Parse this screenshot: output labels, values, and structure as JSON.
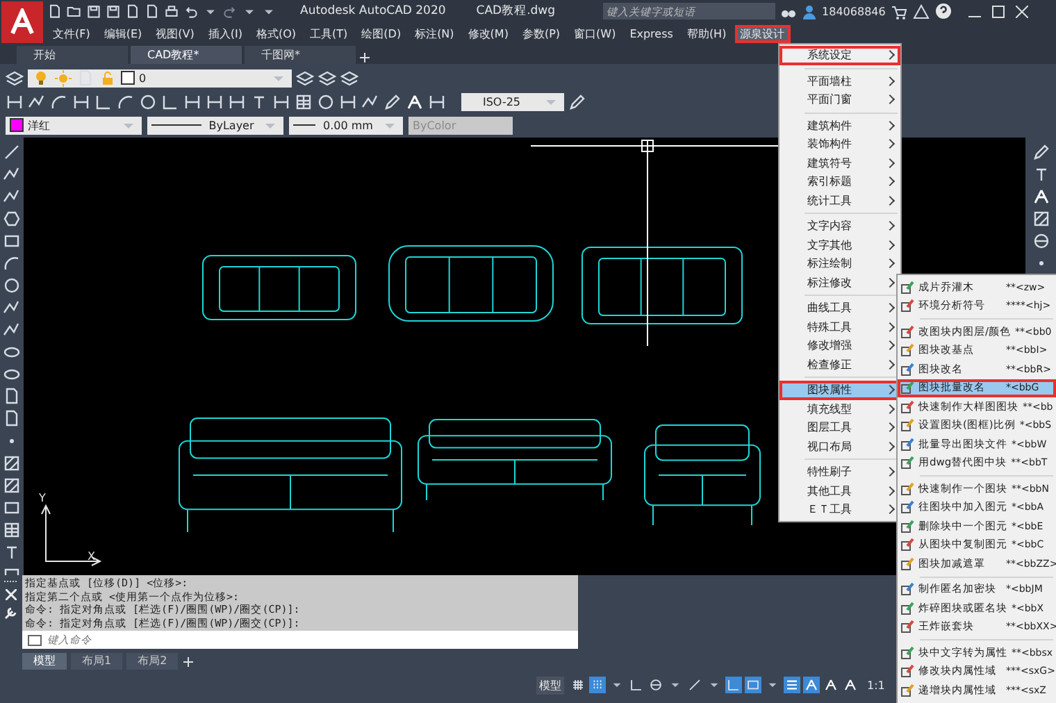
{
  "title_bar": {
    "app_title": "Autodesk AutoCAD 2020",
    "file_name": "CAD教程.dwg",
    "search": {
      "placeholder": "键入关键字或短语"
    },
    "user": "184068846"
  },
  "menu_bar": [
    {
      "label": "文件(F)",
      "selected": false,
      "highlighted": false
    },
    {
      "label": "编辑(E)",
      "selected": false,
      "highlighted": false
    },
    {
      "label": "视图(V)",
      "selected": false,
      "highlighted": false
    },
    {
      "label": "插入(I)",
      "selected": false,
      "highlighted": false
    },
    {
      "label": "格式(O)",
      "selected": false,
      "highlighted": false
    },
    {
      "label": "工具(T)",
      "selected": false,
      "highlighted": false
    },
    {
      "label": "绘图(D)",
      "selected": false,
      "highlighted": false
    },
    {
      "label": "标注(N)",
      "selected": false,
      "highlighted": false
    },
    {
      "label": "修改(M)",
      "selected": false,
      "highlighted": false
    },
    {
      "label": "参数(P)",
      "selected": false,
      "highlighted": false
    },
    {
      "label": "窗口(W)",
      "selected": false,
      "highlighted": false
    },
    {
      "label": "Express",
      "selected": false,
      "highlighted": false
    },
    {
      "label": "帮助(H)",
      "selected": false,
      "highlighted": false
    },
    {
      "label": "源泉设计",
      "selected": true,
      "highlighted": true
    }
  ],
  "doc_tabs": [
    {
      "label": "开始",
      "selected": false
    },
    {
      "label": "CAD教程*",
      "selected": true
    },
    {
      "label": "千图网*",
      "selected": false
    }
  ],
  "layer_toolbar": {
    "layer": "0"
  },
  "dim_style": "ISO-25",
  "properties": {
    "color_name": "洋红",
    "color": "#ff00ff",
    "linetype": "ByLayer",
    "lineweight": "0.00 mm",
    "plot_style": "ByColor",
    "plot_style_disabled": true
  },
  "ucs": {
    "x": "X",
    "y": "Y"
  },
  "menu": {
    "groups": [
      [
        {
          "label": "系统设定",
          "selected": false,
          "highlighted": true
        }
      ],
      [
        {
          "label": "平面墙柱",
          "selected": false,
          "highlighted": false
        },
        {
          "label": "平面门窗",
          "selected": false,
          "highlighted": false
        }
      ],
      [
        {
          "label": "建筑构件",
          "selected": false,
          "highlighted": false
        },
        {
          "label": "装饰构件",
          "selected": false,
          "highlighted": false
        },
        {
          "label": "建筑符号",
          "selected": false,
          "highlighted": false
        },
        {
          "label": "索引标题",
          "selected": false,
          "highlighted": false
        },
        {
          "label": "统计工具",
          "selected": false,
          "highlighted": false
        }
      ],
      [
        {
          "label": "文字内容",
          "selected": false,
          "highlighted": false
        },
        {
          "label": "文字其他",
          "selected": false,
          "highlighted": false
        },
        {
          "label": "标注绘制",
          "selected": false,
          "highlighted": false
        },
        {
          "label": "标注修改",
          "selected": false,
          "highlighted": false
        }
      ],
      [
        {
          "label": "曲线工具",
          "selected": false,
          "highlighted": false
        },
        {
          "label": "特殊工具",
          "selected": false,
          "highlighted": false
        },
        {
          "label": "修改增强",
          "selected": false,
          "highlighted": false
        },
        {
          "label": "检查修正",
          "selected": false,
          "highlighted": false
        }
      ],
      [
        {
          "label": "图块属性",
          "selected": true,
          "highlighted": true
        },
        {
          "label": "填充线型",
          "selected": false,
          "highlighted": false
        },
        {
          "label": "图层工具",
          "selected": false,
          "highlighted": false
        },
        {
          "label": "视口布局",
          "selected": false,
          "highlighted": false
        }
      ],
      [
        {
          "label": "特性刷子",
          "selected": false,
          "highlighted": false
        },
        {
          "label": "其他工具",
          "selected": false,
          "highlighted": false
        },
        {
          "label": "ＥＴ工具",
          "selected": false,
          "highlighted": false
        }
      ]
    ]
  },
  "submenu": {
    "groups": [
      [
        {
          "label": "成片乔灌木",
          "shortcut": "**<zw>",
          "selected": false,
          "highlighted": false
        },
        {
          "label": "环境分析符号",
          "shortcut": "****<hj>",
          "selected": false,
          "highlighted": false
        }
      ],
      [
        {
          "label": "改图块内图层/颜色",
          "shortcut": "**<bb0",
          "selected": false,
          "highlighted": false
        },
        {
          "label": "图块改基点",
          "shortcut": "**<bbI>",
          "selected": false,
          "highlighted": false
        },
        {
          "label": "图块改名",
          "shortcut": "**<bbR>",
          "selected": false,
          "highlighted": false
        },
        {
          "label": "图块批量改名",
          "shortcut": "*<bbG",
          "selected": true,
          "highlighted": true
        },
        {
          "label": "快速制作大样图图块",
          "shortcut": "**<bb",
          "selected": false,
          "highlighted": false
        },
        {
          "label": "设置图块(图框)比例",
          "shortcut": "*<bbS",
          "selected": false,
          "highlighted": false
        },
        {
          "label": "批量导出图块文件",
          "shortcut": "*<bbW",
          "selected": false,
          "highlighted": false
        },
        {
          "label": "用dwg替代图中块",
          "shortcut": "**<bbT",
          "selected": false,
          "highlighted": false
        }
      ],
      [
        {
          "label": "快速制作一个图块",
          "shortcut": "**<bbN",
          "selected": false,
          "highlighted": false
        },
        {
          "label": "往图块中加入图元",
          "shortcut": "*<bbA",
          "selected": false,
          "highlighted": false
        },
        {
          "label": "删除块中一个图元",
          "shortcut": "*<bbE",
          "selected": false,
          "highlighted": false
        },
        {
          "label": "从图块中复制图元",
          "shortcut": "*<bbC",
          "selected": false,
          "highlighted": false
        },
        {
          "label": "图块加减遮罩",
          "shortcut": "**<bbZZ>",
          "selected": false,
          "highlighted": false
        }
      ],
      [
        {
          "label": "制作匿名加密块",
          "shortcut": "*<bbJM",
          "selected": false,
          "highlighted": false
        },
        {
          "label": "炸碎图块或匿名块",
          "shortcut": "*<bbX",
          "selected": false,
          "highlighted": false
        },
        {
          "label": "王炸嵌套块",
          "shortcut": "**<bbXX>",
          "selected": false,
          "highlighted": false
        }
      ],
      [
        {
          "label": "块中文字转为属性",
          "shortcut": "**<bbsx",
          "selected": false,
          "highlighted": false
        },
        {
          "label": "修改块内属性域",
          "shortcut": "***<sxG>",
          "selected": false,
          "highlighted": false
        },
        {
          "label": "递增块内属性域",
          "shortcut": "***<sxZ",
          "selected": false,
          "highlighted": false
        }
      ]
    ]
  },
  "command_history": [
    "指定基点或 [位移(D)] <位移>:",
    "指定第二个点或 <使用第一个点作为位移>:",
    "命令: 指定对角点或 [栏选(F)/圈围(WP)/圈交(CP)]:",
    "命令: 指定对角点或 [栏选(F)/圈围(WP)/圈交(CP)]:"
  ],
  "command_input": {
    "placeholder": "键入命令"
  },
  "layout_tabs": [
    {
      "label": "模型",
      "selected": true
    },
    {
      "label": "布局1",
      "selected": false
    },
    {
      "label": "布局2",
      "selected": false
    }
  ],
  "status_bar": {
    "model": "模型",
    "scale": "1:1"
  }
}
